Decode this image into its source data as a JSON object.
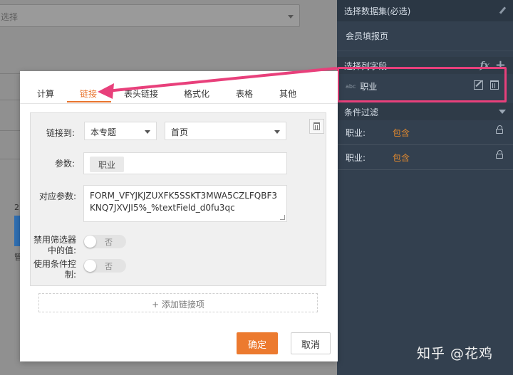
{
  "background": {
    "select_placeholder": "选择",
    "axis_label": "2",
    "bar_label": "管"
  },
  "right_panel": {
    "dataset_header": "选择数据集(必选)",
    "dataset_name": "会员填报页",
    "columns_header": "选择列字段",
    "fx_label": "fx",
    "add_label": "+",
    "field": {
      "type": "abc",
      "name": "职业"
    },
    "filter_header": "条件过滤",
    "filters": [
      {
        "key": "职业:",
        "op": "包含"
      },
      {
        "key": "职业:",
        "op": "包含"
      }
    ]
  },
  "dialog": {
    "tabs": [
      "计算",
      "链接",
      "表头链接",
      "格式化",
      "表格",
      "其他"
    ],
    "active_tab": "链接",
    "link_to_label": "链接到:",
    "link_target": "本专题",
    "link_page": "首页",
    "params_label": "参数:",
    "param_tag": "职业",
    "mapping_label": "对应参数:",
    "mapping_value": "FORM_VFYJKJZUXFK5SSKT3MWA5CZLFQBF3KNQ7JXVJI5%_%textField_d0fu3qc",
    "disable_filter_label_1": "禁用筛选器",
    "disable_filter_label_2": "中的值:",
    "disable_filter_value": "否",
    "use_condition_label_1": "使用条件控",
    "use_condition_label_2": "制:",
    "use_condition_value": "否",
    "add_link_label": "+ 添加链接项",
    "ok_label": "确定",
    "cancel_label": "取消"
  },
  "watermark": "知乎 @花鸡",
  "colors": {
    "accent": "#ec7a2f",
    "highlight": "#e8407b",
    "panel": "#33404f"
  }
}
